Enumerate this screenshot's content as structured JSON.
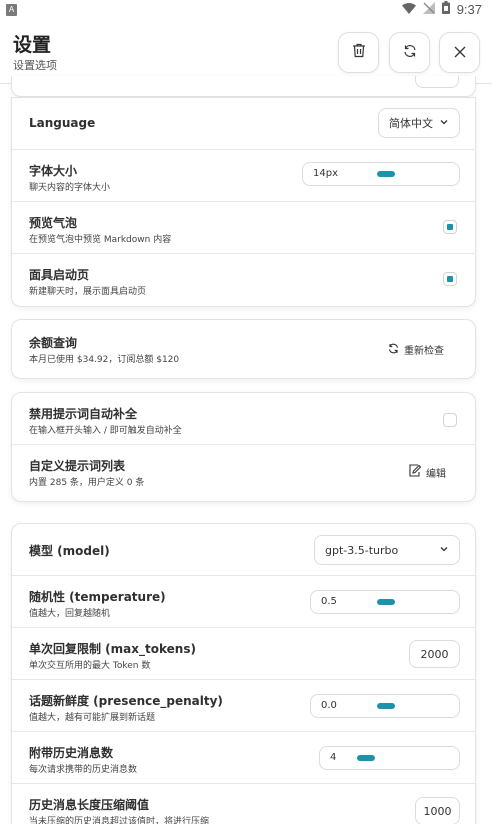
{
  "status_bar": {
    "left_icon_letter": "A",
    "time": "9:37"
  },
  "header": {
    "title": "设置",
    "subtitle": "设置选项",
    "buttons": [
      "trash-icon",
      "refresh-icon",
      "close-icon"
    ]
  },
  "card_appearance": {
    "language": {
      "label": "Language",
      "value": "简体中文"
    },
    "font_size": {
      "label": "字体大小",
      "desc": "聊天内容的字体大小",
      "value": "14px",
      "level": 0.45
    },
    "preview_bubble": {
      "label": "预览气泡",
      "desc": "在预览气泡中预览 Markdown 内容",
      "checked": true
    },
    "mask_launch": {
      "label": "面具启动页",
      "desc": "新建聊天时，展示面具启动页",
      "checked": true
    }
  },
  "card_balance": {
    "label": "余额查询",
    "desc": "本月已使用 $34.92，订阅总额 $120",
    "action": "重新检查"
  },
  "card_prompts": {
    "disable_autocomplete": {
      "label": "禁用提示词自动补全",
      "desc": "在输入框开头输入 / 即可触发自动补全",
      "checked": false
    },
    "custom_prompts": {
      "label": "自定义提示词列表",
      "desc": "内置 285 条，用户定义 0 条",
      "action": "编辑"
    }
  },
  "card_model": {
    "model": {
      "label": "模型 (model)",
      "value": "gpt-3.5-turbo"
    },
    "temperature": {
      "label": "随机性 (temperature)",
      "desc": "值越大，回复越随机",
      "value": "0.5",
      "level": 0.4
    },
    "max_tokens": {
      "label": "单次回复限制 (max_tokens)",
      "desc": "单次交互所用的最大 Token 数",
      "value": "2000"
    },
    "presence_penalty": {
      "label": "话题新鲜度 (presence_penalty)",
      "desc": "值越大，越有可能扩展到新话题",
      "value": "0.0",
      "level": 0.4
    },
    "history_count": {
      "label": "附带历史消息数",
      "desc": "每次请求携带的历史消息数",
      "value": "4",
      "level": 0.1
    },
    "compress_threshold": {
      "label": "历史消息长度压缩阈值",
      "desc": "当未压缩的历史消息超过该值时，将进行压缩",
      "value": "1000"
    }
  },
  "colors": {
    "accent": "#1d93ab",
    "border": "#e3e3e3"
  }
}
